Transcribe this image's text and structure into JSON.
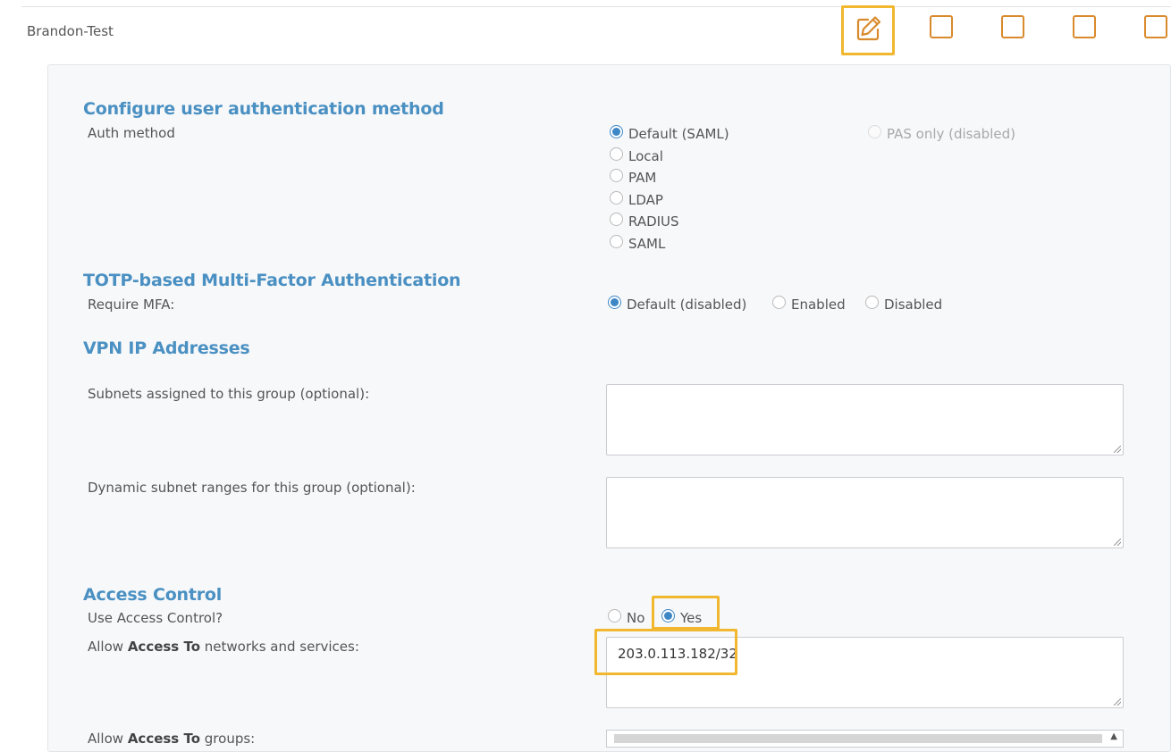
{
  "group": {
    "name": "Brandon-Test"
  },
  "auth": {
    "heading": "Configure user authentication method",
    "label": "Auth method",
    "options": [
      "Default (SAML)",
      "Local",
      "PAM",
      "LDAP",
      "RADIUS",
      "SAML"
    ],
    "selected": "Default (SAML)",
    "pas_only": "PAS only (disabled)"
  },
  "mfa": {
    "heading": "TOTP-based Multi-Factor Authentication",
    "label": "Require MFA:",
    "options": [
      "Default (disabled)",
      "Enabled",
      "Disabled"
    ],
    "selected": "Default (disabled)"
  },
  "vpn": {
    "heading": "VPN IP Addresses",
    "subnets_label": "Subnets assigned to this group (optional):",
    "subnets_value": "",
    "dynamic_label": "Dynamic subnet ranges for this group (optional):",
    "dynamic_value": ""
  },
  "access": {
    "heading": "Access Control",
    "use_label": "Use Access Control?",
    "options": [
      "No",
      "Yes"
    ],
    "selected": "Yes",
    "allow_prefix": "Allow ",
    "allow_bold": "Access To",
    "allow_suffix": " networks and services:",
    "allow_value": "203.0.113.182/32",
    "groups_prefix": "Allow ",
    "groups_bold": "Access To",
    "groups_suffix": " groups:"
  },
  "colors": {
    "accent": "#4a90c2",
    "highlight": "#f0b72f",
    "icon": "#d98a2c",
    "radio": "#3d87c6"
  },
  "icons": {
    "edit": "pencil-edit-icon"
  }
}
